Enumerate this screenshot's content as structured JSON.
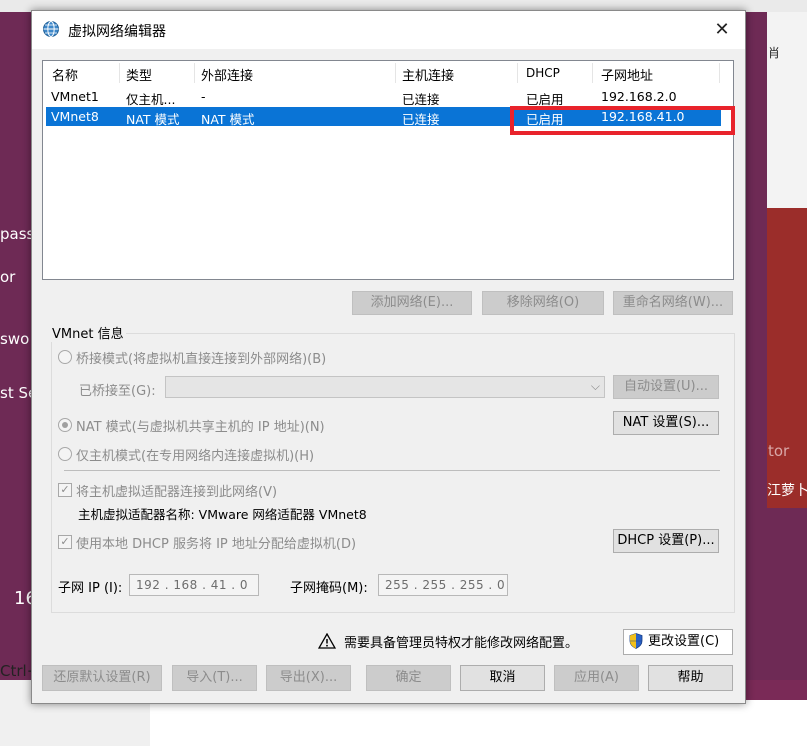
{
  "window": {
    "title": "虚拟网络编辑器",
    "close_glyph": "✕"
  },
  "table": {
    "headers": [
      "名称",
      "类型",
      "外部连接",
      "主机连接",
      "DHCP",
      "子网地址"
    ],
    "rows": [
      {
        "name": "VMnet1",
        "type": "仅主机...",
        "external": "-",
        "host": "已连接",
        "dhcp": "已启用",
        "subnet": "192.168.2.0"
      },
      {
        "name": "VMnet8",
        "type": "NAT 模式",
        "external": "NAT 模式",
        "host": "已连接",
        "dhcp": "已启用",
        "subnet": "192.168.41.0",
        "selected": true
      }
    ]
  },
  "table_buttons": {
    "add": "添加网络(E)...",
    "remove": "移除网络(O)",
    "rename": "重命名网络(W)..."
  },
  "vmnet_info": {
    "label": "VMnet 信息",
    "bridged_mode": "桥接模式(将虚拟机直接连接到外部网络)(B)",
    "bridged_to_label": "已桥接至(G):",
    "bridged_to_value": "",
    "auto_settings": "自动设置(U)...",
    "nat_mode": "NAT 模式(与虚拟机共享主机的 IP 地址)(N)",
    "nat_settings": "NAT 设置(S)...",
    "host_only_mode": "仅主机模式(在专用网络内连接虚拟机)(H)",
    "connect_adapter": "将主机虚拟适配器连接到此网络(V)",
    "adapter_name": "主机虚拟适配器名称: VMware 网络适配器 VMnet8",
    "use_dhcp": "使用本地 DHCP 服务将 IP 地址分配给虚拟机(D)",
    "dhcp_settings": "DHCP 设置(P)...",
    "subnet_ip_label": "子网 IP (I):",
    "subnet_ip_value": "192 . 168 . 41 . 0",
    "subnet_mask_label": "子网掩码(M):",
    "subnet_mask_value": "255 . 255 . 255 . 0",
    "selected_mode": "nat"
  },
  "admin_notice": {
    "text": "需要具备管理员特权才能修改网络配置。",
    "change_settings": "更改设置(C)"
  },
  "footer_buttons": {
    "restore": "还原默认设置(R)",
    "import": "导入(T)...",
    "export": "导出(X)...",
    "ok": "确定",
    "cancel": "取消",
    "apply": "应用(A)",
    "help": "帮助"
  },
  "background_text": {
    "pass": "pass",
    "or": "or",
    "swo": "swo",
    "st_se": "st Se",
    "num": "16",
    "ctrl": "Ctrl+",
    "right_tor": "tor",
    "right_red": "江萝卜",
    "right_top": "肖"
  },
  "colors": {
    "selection": "#0a74d6",
    "highlight_box": "#e8232b"
  }
}
